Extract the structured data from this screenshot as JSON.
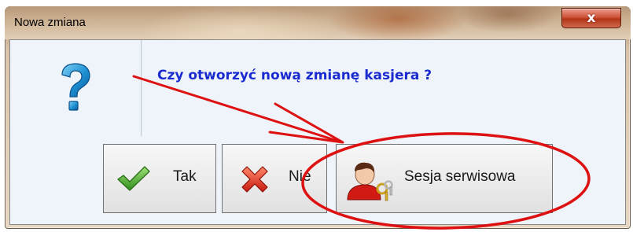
{
  "window": {
    "title": "Nowa zmiana",
    "close_glyph": "x"
  },
  "dialog": {
    "message": "Czy otworzyć nową zmianę kasjera ?",
    "icon": "question-icon",
    "message_color": "#1a2bd0"
  },
  "buttons": {
    "yes": {
      "label": "Tak",
      "icon": "checkmark-icon"
    },
    "no": {
      "label": "Nie",
      "icon": "red-x-icon"
    },
    "service": {
      "label": "Sesja serwisowa",
      "icon": "user-keys-icon"
    }
  },
  "annotation": {
    "type": "red-arrow-and-ellipse",
    "color": "#dd1111",
    "target": "service-session-button"
  }
}
